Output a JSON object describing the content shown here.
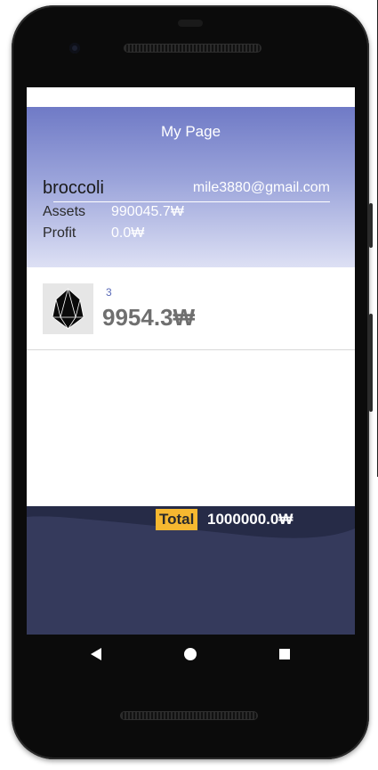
{
  "app": {
    "title": "My Page"
  },
  "profile": {
    "username": "broccoli",
    "email": "mile3880@gmail.com",
    "assets_label": "Assets",
    "assets_value": "990045.7₩",
    "profit_label": "Profit",
    "profit_value": "0.0₩"
  },
  "holdings": [
    {
      "icon": "eos-coin-icon",
      "count": "3",
      "value": "9954.3₩"
    }
  ],
  "footer": {
    "total_label": "Total",
    "total_value": "1000000.0₩"
  },
  "nav": {
    "back_icon": "back-triangle-icon",
    "home_icon": "home-circle-icon",
    "recents_icon": "recents-square-icon"
  },
  "colors": {
    "header_top": "#6f7ac6",
    "header_bottom": "#dde0f4",
    "total_badge": "#f6b830",
    "bottom_panel": "#353a5c"
  }
}
